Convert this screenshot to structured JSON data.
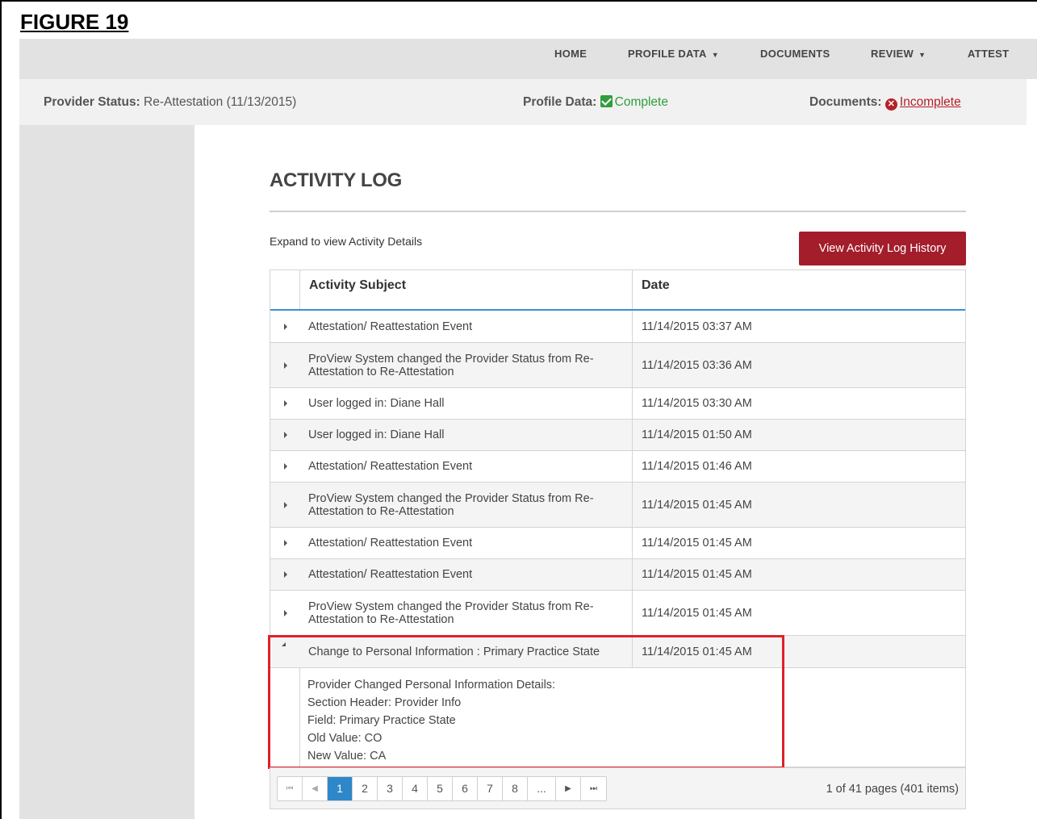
{
  "figure_label": "FIGURE 19",
  "nav": {
    "home": "HOME",
    "profile_data": "PROFILE DATA",
    "documents": "DOCUMENTS",
    "review": "REVIEW",
    "attest": "ATTEST",
    "caret": "▼"
  },
  "status": {
    "provider_status_label": "Provider Status:",
    "provider_status_value": "Re-Attestation (11/13/2015)",
    "profile_data_label": "Profile Data:",
    "profile_data_value": "Complete",
    "documents_label": "Documents:",
    "documents_value": "Incomplete",
    "complete_color": "#2e9e3e",
    "incomplete_color": "#b52025"
  },
  "page": {
    "title": "ACTIVITY LOG",
    "expand_hint": "Expand to view Activity Details",
    "history_button": "View Activity Log History"
  },
  "grid": {
    "columns": [
      "Activity Subject",
      "Date"
    ],
    "rows": [
      {
        "subject": "Attestation/ Reattestation Event",
        "date": "11/14/2015 03:37 AM"
      },
      {
        "subject": "ProView System changed the Provider Status from Re-Attestation to Re-Attestation",
        "date": "11/14/2015 03:36 AM"
      },
      {
        "subject": "User logged in: Diane Hall",
        "date": "11/14/2015 03:30 AM"
      },
      {
        "subject": "User logged in: Diane Hall",
        "date": "11/14/2015 01:50 AM"
      },
      {
        "subject": "Attestation/ Reattestation Event",
        "date": "11/14/2015 01:46 AM"
      },
      {
        "subject": "ProView System changed the Provider Status from Re-Attestation to Re-Attestation",
        "date": "11/14/2015 01:45 AM"
      },
      {
        "subject": "Attestation/ Reattestation Event",
        "date": "11/14/2015 01:45 AM"
      },
      {
        "subject": "Attestation/ Reattestation Event",
        "date": "11/14/2015 01:45 AM"
      },
      {
        "subject": "ProView System changed the Provider Status from Re-Attestation to Re-Attestation",
        "date": "11/14/2015 01:45 AM"
      },
      {
        "subject": "Change to Personal Information : Primary Practice State",
        "date": "11/14/2015 01:45 AM"
      }
    ],
    "expanded_detail": [
      "Provider Changed Personal Information Details:",
      "Section Header: Provider Info",
      "Field: Primary Practice State",
      "Old Value: CO",
      "New Value: CA"
    ]
  },
  "pager": {
    "first": "⏮",
    "prev": "◀",
    "pages": [
      "1",
      "2",
      "3",
      "4",
      "5",
      "6",
      "7",
      "8",
      "..."
    ],
    "current_page": "1",
    "next": "▶",
    "last": "⏭",
    "info": "1 of 41 pages (401 items)"
  },
  "colors": {
    "accent_button": "#a31d2a",
    "active_page": "#2e87c8",
    "highlight_border": "#e0202a"
  }
}
